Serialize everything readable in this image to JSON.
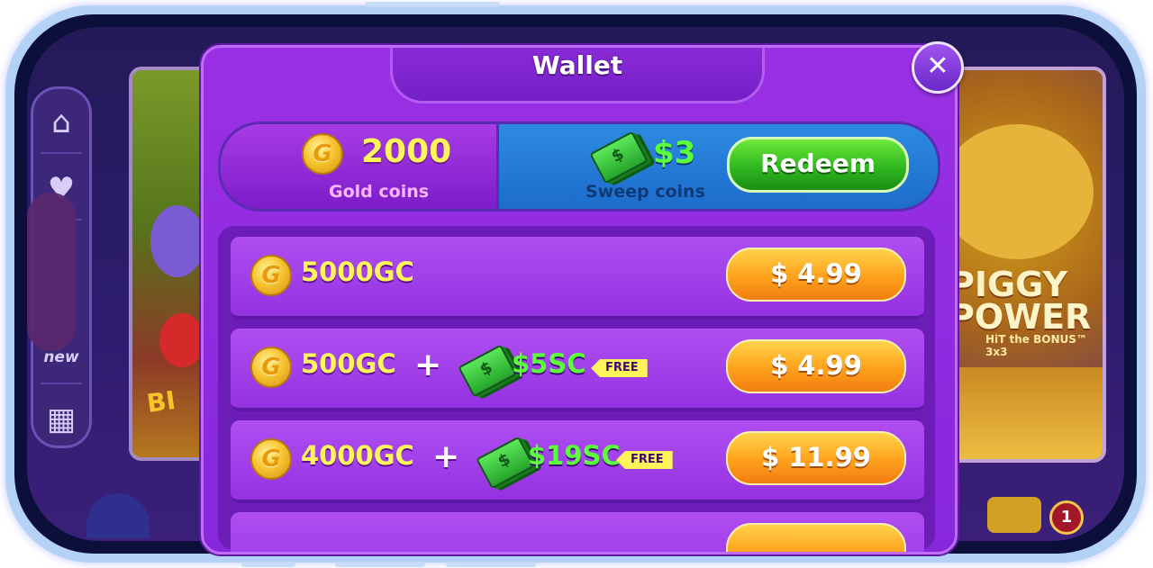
{
  "background": {
    "new_label": "new",
    "piggy_title": "PIGGY POWER",
    "piggy_sub": "HiT the BONUS™ 3x3",
    "left_game_text": "BI",
    "mail_badge": "1"
  },
  "wallet": {
    "title": "Wallet",
    "close_glyph": "✕",
    "gold": {
      "amount": "2000",
      "label": "Gold coins"
    },
    "sweep": {
      "amount": "$3",
      "label": "Sweep coins"
    },
    "redeem_label": "Redeem",
    "coin_glyph": "G",
    "cash_glyph": "$",
    "offers": [
      {
        "gc": "5000GC",
        "price": "$ 4.99"
      },
      {
        "gc": "500GC",
        "plus": "+",
        "sc": "$5SC",
        "free": "FREE",
        "price": "$ 4.99"
      },
      {
        "gc": "4000GC",
        "plus": "+",
        "sc": "$19SC",
        "free": "FREE",
        "price": "$ 11.99"
      }
    ]
  },
  "colors": {
    "modal": "#8f2ce0",
    "gold_text": "#fff45a",
    "sweep_text": "#5bff3a",
    "redeem_green": "#2eb81f",
    "price_orange": "#ffa11c"
  },
  "icons": [
    "home-icon",
    "heart-icon",
    "slot-machine-icon",
    "coin-icon",
    "cash-stack-icon",
    "close-icon",
    "mailbox-icon"
  ]
}
